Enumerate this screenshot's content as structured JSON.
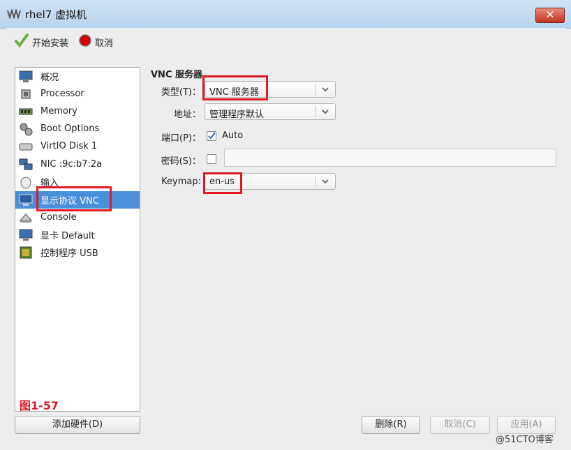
{
  "window": {
    "title": "rhel7 虚拟机",
    "close_symbol": "✕"
  },
  "toolbar": {
    "start_install": "开始安装",
    "cancel": "取消"
  },
  "hw_list": [
    {
      "label": "概况",
      "icon": "monitor-icon"
    },
    {
      "label": "Processor",
      "icon": "cpu-icon"
    },
    {
      "label": "Memory",
      "icon": "memory-icon"
    },
    {
      "label": "Boot Options",
      "icon": "gears-icon"
    },
    {
      "label": "VirtIO Disk 1",
      "icon": "disk-icon"
    },
    {
      "label": "NIC :9c:b7:2a",
      "icon": "network-icon"
    },
    {
      "label": "输入",
      "icon": "mouse-icon"
    },
    {
      "label": "显示协议 VNC",
      "icon": "display-icon"
    },
    {
      "label": "Console",
      "icon": "console-icon"
    },
    {
      "label": "显卡 Default",
      "icon": "video-card-icon"
    },
    {
      "label": "控制程序 USB",
      "icon": "usb-controller-icon"
    }
  ],
  "selected_item": "显示协议 VNC",
  "figure_label": "图1-57",
  "add_hardware": "添加硬件(D)",
  "vnc": {
    "section_title": "VNC 服务器",
    "type_label": "类型(T)：",
    "type_value": "VNC 服务器",
    "address_label": "地址：",
    "address_value": "管理程序默认",
    "port_label": "端口(P)：",
    "port_auto": "Auto",
    "port_auto_checked": true,
    "password_label": "密码(S)：",
    "password_checked": false,
    "keymap_label": "Keymap:",
    "keymap_value": "en-us"
  },
  "buttons": {
    "remove": "删除(R)",
    "cancel": "取消(C)",
    "apply": "应用(A)"
  },
  "watermark": "@51CTO博客",
  "colors": {
    "selection": "#4a90d9",
    "highlight_box": "#e0182a",
    "titlebar": "#c4dbf3"
  }
}
